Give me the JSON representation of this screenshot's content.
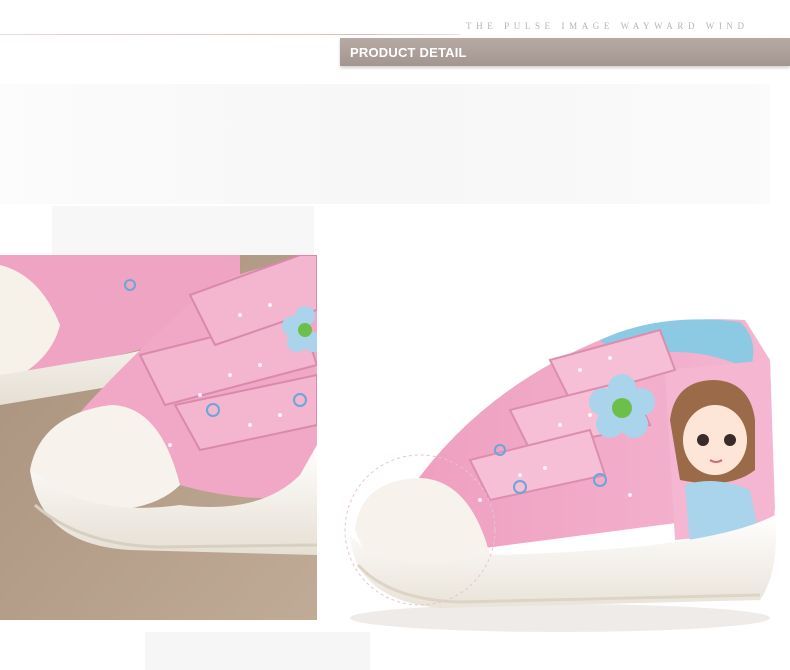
{
  "header": {
    "tagline": "THE PULSE IMAGE WAYWARD WIND",
    "section_title": "PRODUCT DETAIL"
  },
  "colors": {
    "header_bar": "#ab9e98",
    "canvas_pink": "#f1a8c6",
    "sole_white": "#f3efe8",
    "flower_blue": "#a9d4ec",
    "flower_center": "#6cc04a",
    "lining_blue": "#8cc9e3",
    "floor_beige": "#b39d88"
  },
  "images": {
    "closeup": "shoe-toe-closeup-photo",
    "product": "pink-high-top-velcro-shoe-photo"
  }
}
